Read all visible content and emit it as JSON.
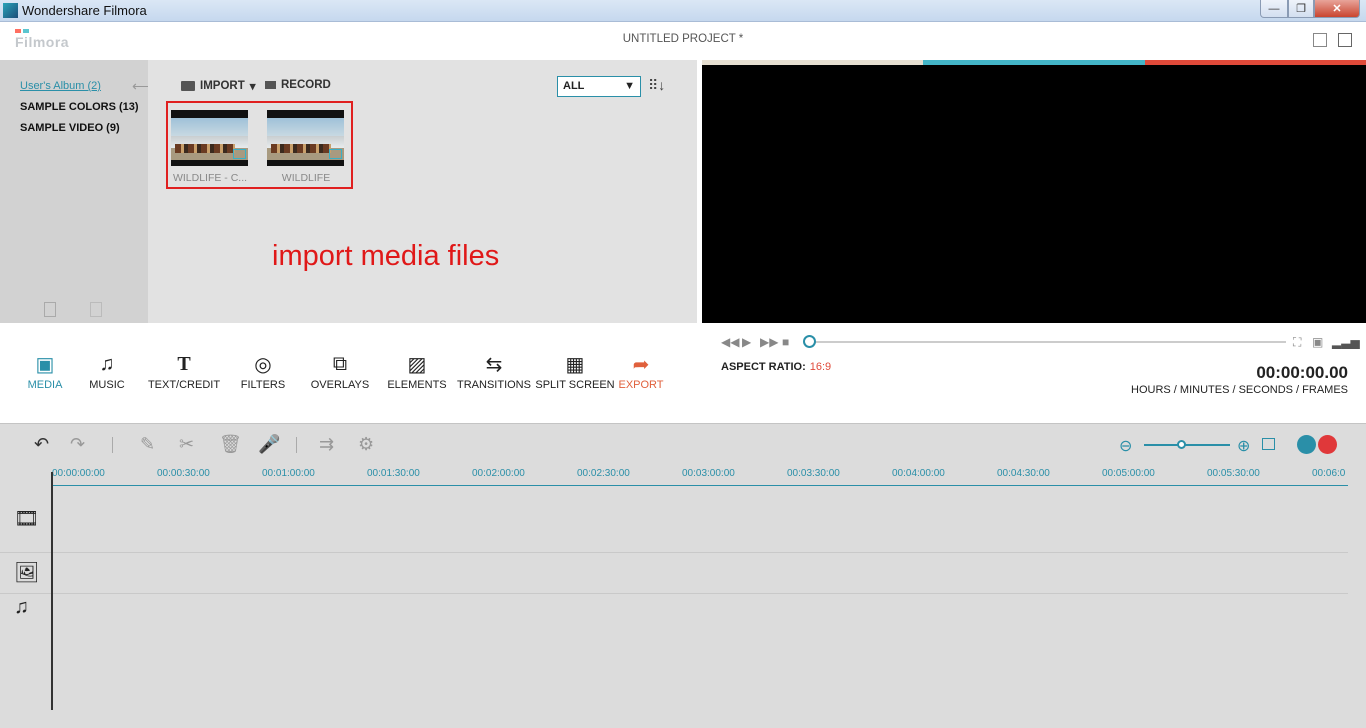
{
  "window": {
    "title": "Wondershare Filmora",
    "min": "—",
    "max": "❐",
    "close": "✕"
  },
  "header": {
    "logo": "Filmora",
    "project_title": "UNTITLED PROJECT *"
  },
  "library": {
    "albums": [
      "User's Album (2)",
      "SAMPLE COLORS (13)",
      "SAMPLE VIDEO (9)"
    ],
    "import_label": "IMPORT",
    "record_label": "RECORD",
    "filter_value": "ALL",
    "items": [
      {
        "label": "WILDLIFE - C..."
      },
      {
        "label": "WILDLIFE"
      }
    ]
  },
  "annotation": "import media files",
  "toolbar": {
    "tools": [
      "MEDIA",
      "MUSIC",
      "TEXT/CREDIT",
      "FILTERS",
      "OVERLAYS",
      "ELEMENTS",
      "TRANSITIONS",
      "SPLIT SCREEN",
      "EXPORT"
    ]
  },
  "preview": {
    "aspect_label": "ASPECT RATIO:",
    "aspect_value": "16:9",
    "timecode": "00:00:00.00",
    "timecode_units": "HOURS / MINUTES / SECONDS / FRAMES",
    "progress": 0
  },
  "timeline": {
    "ticks": [
      "00:00:00:00",
      "00:00:30:00",
      "00:01:00:00",
      "00:01:30:00",
      "00:02:00:00",
      "00:02:30:00",
      "00:03:00:00",
      "00:03:30:00",
      "00:04:00:00",
      "00:04:30:00",
      "00:05:00:00",
      "00:05:30:00",
      "00:06:0"
    ]
  },
  "colors": {
    "accent": "#2a8fa8",
    "export": "#e0603c",
    "annotation": "#e01818"
  }
}
